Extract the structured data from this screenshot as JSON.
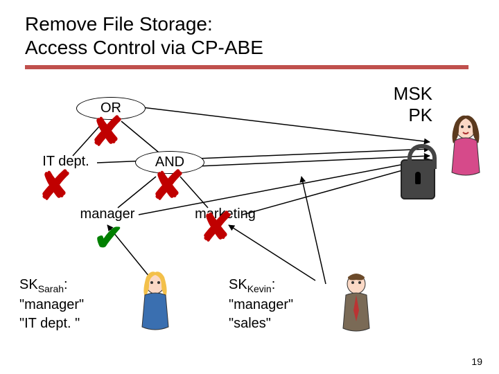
{
  "title_line1": "Remove File Storage:",
  "title_line2": "Access Control via CP-ABE",
  "keys": {
    "msk": "MSK",
    "pk": "PK"
  },
  "tree": {
    "root": "OR",
    "left": "IT dept.",
    "right": "AND",
    "right_left": "manager",
    "right_right": "marketing"
  },
  "marks": {
    "or": "cross",
    "it_dept": "cross",
    "and": "cross",
    "manager": "check",
    "marketing": "cross"
  },
  "sk_sarah": {
    "prefix": "SK",
    "sub": "Sarah",
    "colon": ":",
    "attr1": "\"manager\"",
    "attr2": "\"IT dept. \""
  },
  "sk_kevin": {
    "prefix": "SK",
    "sub": "Kevin",
    "colon": ":",
    "attr1": "\"manager\"",
    "attr2": "\"sales\""
  },
  "page_number": "19"
}
